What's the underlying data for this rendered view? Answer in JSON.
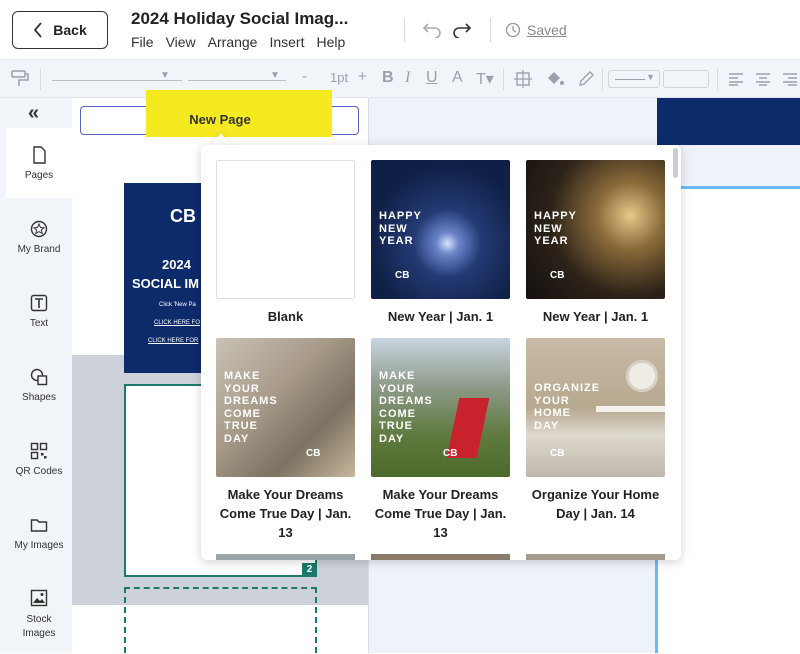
{
  "header": {
    "back_label": "Back",
    "doc_title": "2024 Holiday Social Imag...",
    "menu": [
      "File",
      "View",
      "Arrange",
      "Insert",
      "Help"
    ],
    "saved_label": "Saved"
  },
  "toolbar": {
    "font_size": "1pt",
    "minus": "-",
    "plus": "+"
  },
  "sidebar": {
    "collapse_glyph": "«",
    "items": [
      {
        "label": "Pages",
        "icon": "page-icon"
      },
      {
        "label": "My Brand",
        "icon": "badge-icon"
      },
      {
        "label": "Text",
        "icon": "text-icon"
      },
      {
        "label": "Shapes",
        "icon": "shapes-icon"
      },
      {
        "label": "QR Codes",
        "icon": "qr-icon"
      },
      {
        "label": "My Images",
        "icon": "folder-icon"
      },
      {
        "label": "Stock Images",
        "icon": "image-icon"
      }
    ]
  },
  "canvas": {
    "new_page_label": "New Page",
    "thumb_title_1": "2024",
    "thumb_title_2": "SOCIAL IM",
    "thumb_line_1": "Click 'New Pa",
    "thumb_link_1": "CLICK HERE FO",
    "thumb_link_2": "CLICK HERE FOR",
    "page_number": "2"
  },
  "templates": [
    {
      "caption": "Blank",
      "overlay": ""
    },
    {
      "caption": "New Year | Jan. 1",
      "overlay": "HAPPY\nNEW\nYEAR"
    },
    {
      "caption": "New Year | Jan. 1",
      "overlay": "HAPPY\nNEW\nYEAR"
    },
    {
      "caption": "Make Your Dreams Come True Day | Jan. 13",
      "overlay": "MAKE\nYOUR\nDREAMS\nCOME\nTRUE\nDAY"
    },
    {
      "caption": "Make Your Dreams Come True Day | Jan. 13",
      "overlay": "MAKE\nYOUR\nDREAMS\nCOME\nTRUE\nDAY"
    },
    {
      "caption": "Organize Your Home Day | Jan. 14",
      "overlay": "ORGANIZE\nYOUR\nHOME\nDAY"
    }
  ],
  "colors": {
    "brand_navy": "#0d2a6b",
    "accent_teal": "#1b7a6b",
    "highlight_yellow": "#f5ea1f",
    "button_border": "#5763c8"
  }
}
